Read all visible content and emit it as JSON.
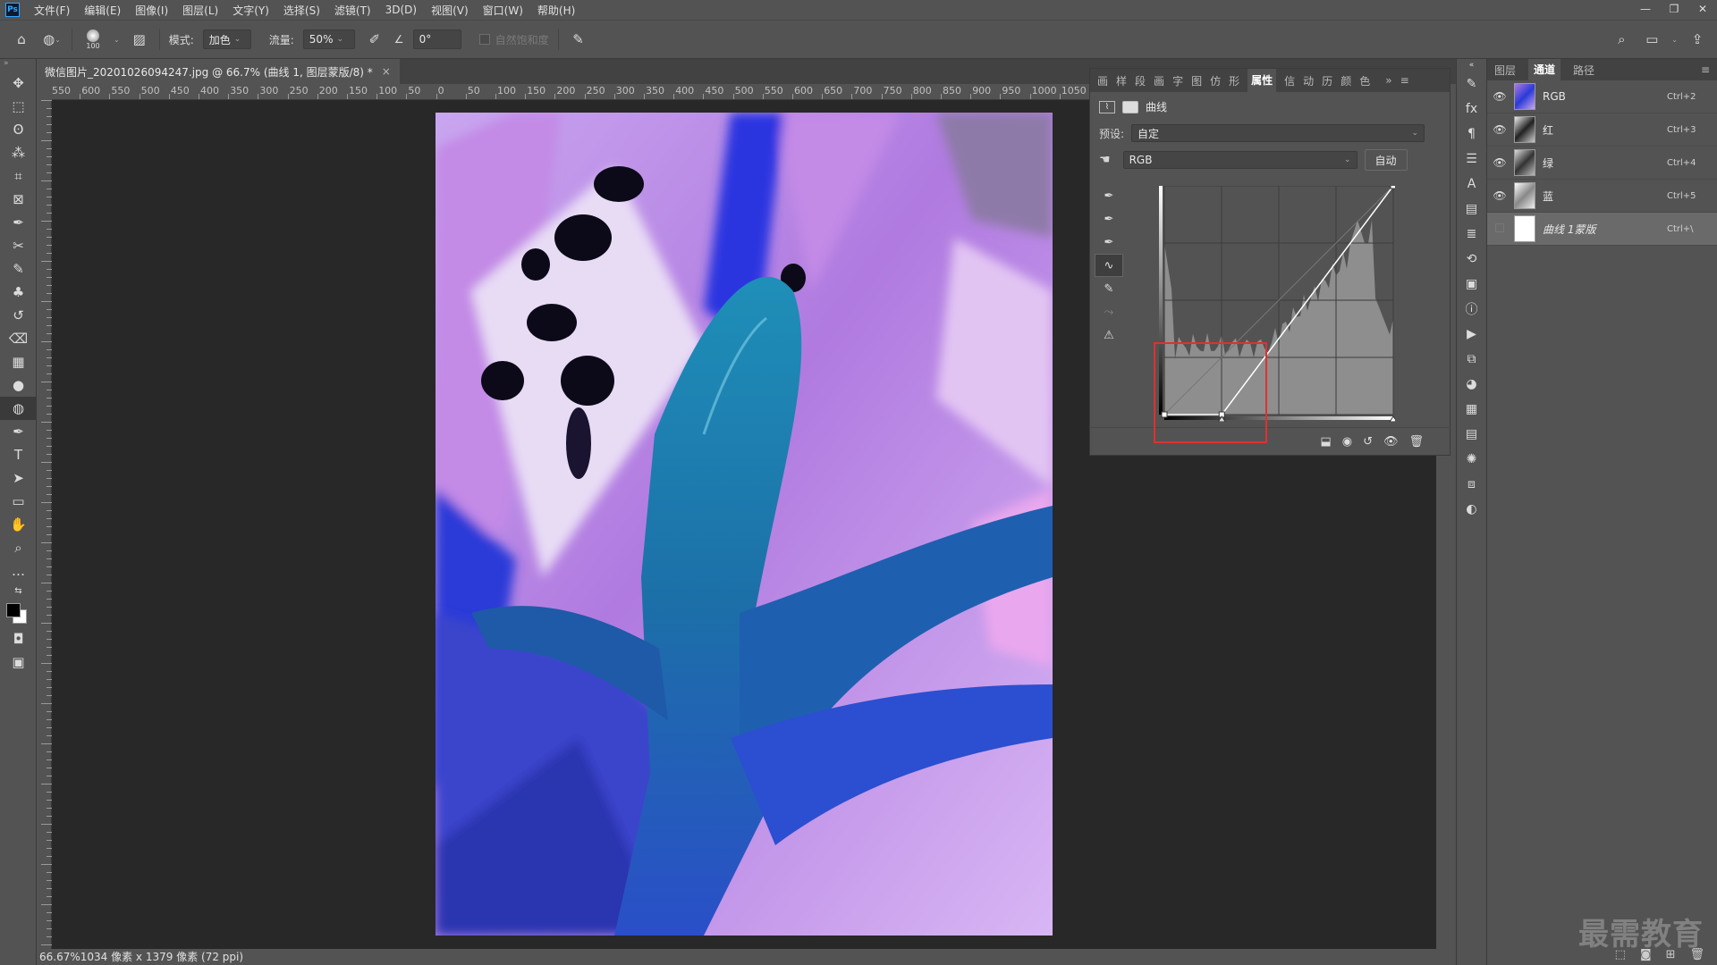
{
  "menubar": {
    "items": [
      "文件(F)",
      "编辑(E)",
      "图像(I)",
      "图层(L)",
      "文字(Y)",
      "选择(S)",
      "滤镜(T)",
      "3D(D)",
      "视图(V)",
      "窗口(W)",
      "帮助(H)"
    ],
    "window_controls": [
      "—",
      "❐",
      "✕"
    ]
  },
  "options": {
    "brush_size": "100",
    "mode_label": "模式:",
    "mode_value": "加色",
    "flow_label": "流量:",
    "flow_value": "50%",
    "angle_value": "0°",
    "vibrance_label": "自然饱和度"
  },
  "document": {
    "tab_title": "微信图片_20201026094247.jpg @ 66.7% (曲线 1, 图层蒙版/8) *",
    "close": "×"
  },
  "ruler": {
    "h_labels": [
      "550",
      "600",
      "550",
      "500",
      "450",
      "400",
      "350",
      "300",
      "250",
      "200",
      "150",
      "100",
      "50",
      "0",
      "50",
      "100",
      "150",
      "200",
      "250",
      "300",
      "350",
      "400",
      "450",
      "500",
      "550",
      "600",
      "650",
      "700",
      "750",
      "800",
      "850",
      "900",
      "950",
      "1000",
      "1050"
    ]
  },
  "status": {
    "text": "66.67%1034 像素 x 1379 像素 (72 ppi)"
  },
  "properties": {
    "tabs": [
      "画",
      "样",
      "段",
      "画",
      "字",
      "图",
      "仿",
      "形",
      "属性",
      "信",
      "动",
      "历",
      "颜",
      "色"
    ],
    "active_tab": "属性",
    "title": "曲线",
    "preset_label": "预设:",
    "preset_value": "自定",
    "channel_value": "RGB",
    "auto_label": "自动",
    "curve": {
      "input": [
        0,
        64,
        255
      ],
      "output": [
        0,
        0,
        255
      ]
    }
  },
  "channels": {
    "tabs": [
      "图层",
      "通道",
      "路径"
    ],
    "active_tab": "通道",
    "rows": [
      {
        "name": "RGB",
        "shortcut": "Ctrl+2"
      },
      {
        "name": "红",
        "shortcut": "Ctrl+3"
      },
      {
        "name": "绿",
        "shortcut": "Ctrl+4"
      },
      {
        "name": "蓝",
        "shortcut": "Ctrl+5"
      },
      {
        "name": "曲线 1蒙版",
        "shortcut": "Ctrl+\\"
      }
    ]
  },
  "watermark": "最需教育",
  "colors": {
    "highlight_box": "#e03030",
    "photo_magenta": "#b07ae0",
    "photo_blue": "#2a3ad8"
  }
}
